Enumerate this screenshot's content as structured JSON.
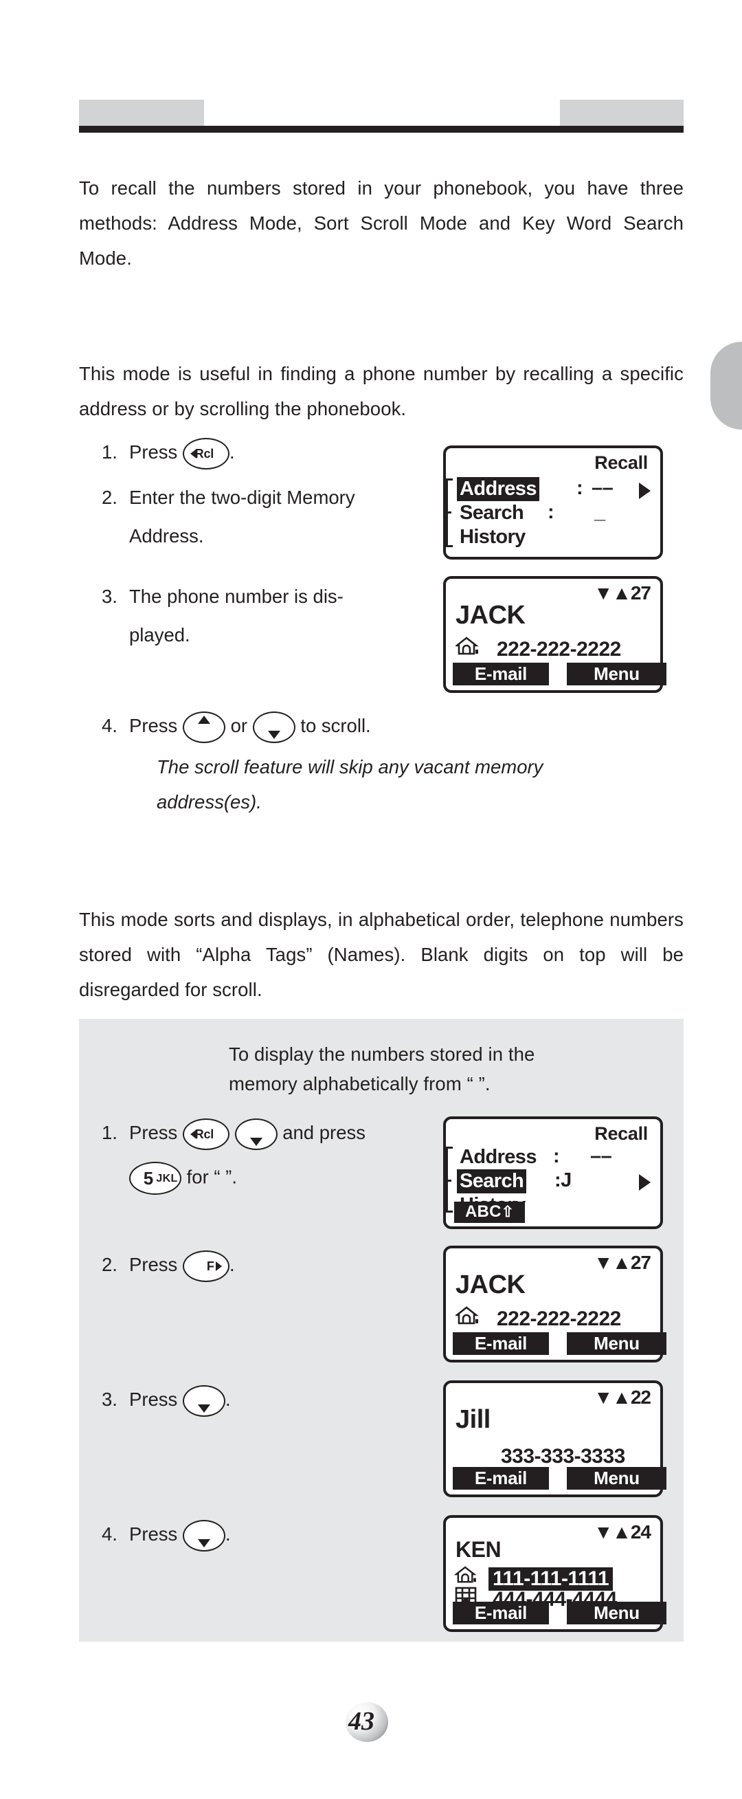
{
  "page": {
    "number": "43",
    "header": {
      "left_tab": "",
      "right_tab": ""
    }
  },
  "intro": {
    "paragraph": "To recall the numbers stored in your phonebook, you have three methods: Address Mode, Sort Scroll Mode and Key Word Search Mode."
  },
  "address_mode": {
    "paragraph": "This mode is useful in finding a phone number by recalling a specific address or by scrolling the phonebook.",
    "steps": [
      {
        "num": "1.",
        "pre": "Press",
        "post": "."
      },
      {
        "num": "2.",
        "text_line1": "Enter the two-digit Memory",
        "text_line2": "Address."
      },
      {
        "num": "3.",
        "text_line1": "The phone number is dis-",
        "text_line2": "played."
      },
      {
        "num": "4.",
        "pre": "Press",
        "mid": "or",
        "post": "to scroll."
      }
    ],
    "note_line1": "The scroll feature will skip any vacant memory",
    "note_line2": "address(es)."
  },
  "sort_scroll_mode": {
    "paragraph": "This mode sorts and displays, in alphabetical order, telephone numbers stored with “Alpha Tags” (Names). Blank digits on top will be disregarded for scroll.",
    "panel_intro_line1": "To display the numbers stored in the",
    "panel_intro_line2": "memory alphabetically from “  ”.",
    "steps": [
      {
        "num": "1.",
        "pre": "Press",
        "mid": "and press",
        "post_pre": "for “  ”."
      },
      {
        "num": "2.",
        "pre": "Press",
        "post": "."
      },
      {
        "num": "3.",
        "pre": "Press",
        "post": "."
      },
      {
        "num": "4.",
        "pre": "Press",
        "post": "."
      }
    ]
  },
  "keys": {
    "rcl": {
      "label": "Rcl",
      "icon": "left-triangle"
    },
    "fn": {
      "label": "F",
      "icon": "right-triangle"
    },
    "up": {
      "label": "",
      "icon": "up-triangle"
    },
    "down": {
      "label": "",
      "icon": "down-triangle"
    },
    "five": {
      "digit": "5",
      "letters": "JKL"
    }
  },
  "screens": {
    "recall_address": {
      "title": "Recall",
      "rows": [
        {
          "label": "Address",
          "selected": true,
          "colon": ":",
          "value": "––"
        },
        {
          "label": "Search",
          "selected": false,
          "colon": ":",
          "value": "_"
        },
        {
          "label": "History",
          "selected": false,
          "colon": "",
          "value": ""
        }
      ],
      "arrow": "right-triangle",
      "soft_bar": null
    },
    "jack": {
      "index": "27",
      "index_arrows": "▼▲",
      "name": "JACK",
      "entries": [
        {
          "icon": "home-icon",
          "number": "222-222-2222",
          "highlight": false
        }
      ],
      "softkeys": {
        "left": "E-mail",
        "right": "Menu"
      },
      "more_arrow": "right-triangle"
    },
    "recall_search": {
      "title": "Recall",
      "rows": [
        {
          "label": "Address",
          "selected": false,
          "colon": ":",
          "value": "––"
        },
        {
          "label": "Search",
          "selected": true,
          "colon": ":J",
          "value": ""
        },
        {
          "label": "History",
          "selected": false,
          "colon": "",
          "value": ""
        }
      ],
      "arrow": "right-triangle",
      "soft_bar": {
        "text": "ABC",
        "icon": "shift-up-icon"
      }
    },
    "jack2": {
      "index": "27",
      "index_arrows": "▼▲",
      "name": "JACK",
      "entries": [
        {
          "icon": "home-icon",
          "number": "222-222-2222",
          "highlight": false
        }
      ],
      "softkeys": {
        "left": "E-mail",
        "right": "Menu"
      },
      "more_arrow": "right-triangle"
    },
    "jill": {
      "index": "22",
      "index_arrows": "▼▲",
      "name": "Jill",
      "entries": [
        {
          "icon": "none",
          "number": "333-333-3333",
          "highlight": false
        }
      ],
      "softkeys": {
        "left": "E-mail",
        "right": "Menu"
      },
      "more_arrow": "right-triangle"
    },
    "ken": {
      "index": "24",
      "index_arrows": "▼▲",
      "name": "KEN",
      "entries": [
        {
          "icon": "home-icon",
          "number": "111-111-1111",
          "highlight": true
        },
        {
          "icon": "office-icon",
          "number": "444-444-4444",
          "highlight": false
        }
      ],
      "softkeys": {
        "left": "E-mail",
        "right": "Menu"
      },
      "more_arrow": "right-triangle"
    }
  },
  "colors": {
    "ink": "#231f20",
    "panel_gray": "#e6e7e8",
    "header_gray": "#d2d3d5",
    "tab_gray": "#bcbec0"
  }
}
